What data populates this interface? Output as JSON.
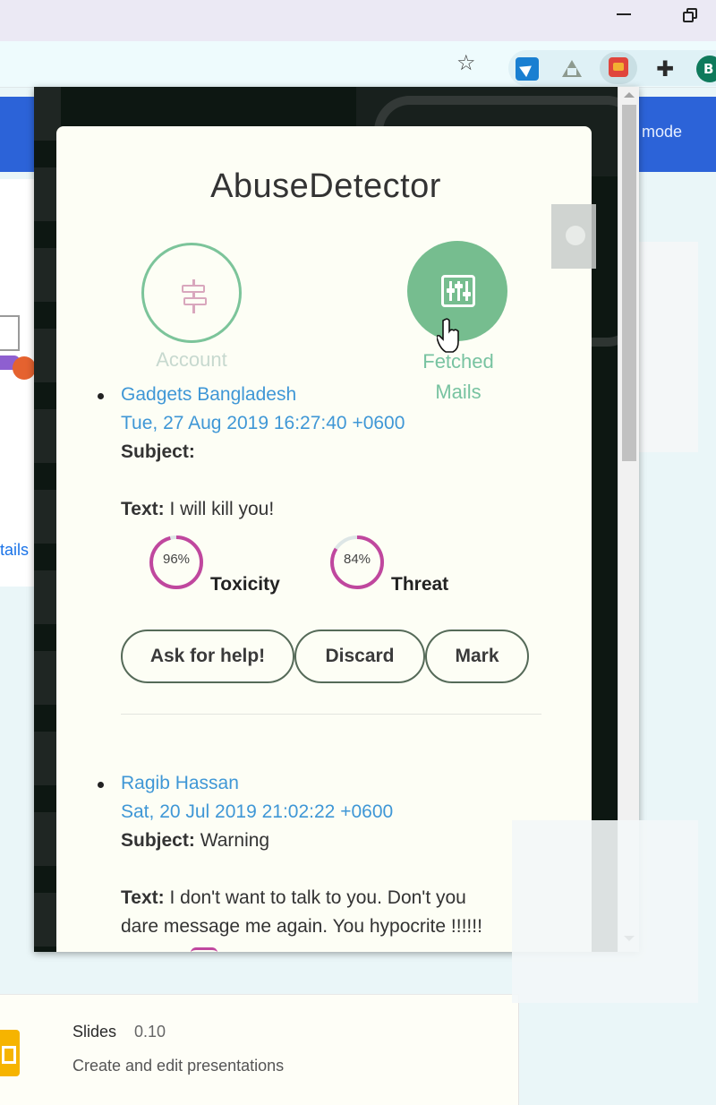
{
  "browser": {
    "avatar_letter": "B",
    "star_icon": "star-icon",
    "extensions": [
      "pointer-extension-icon",
      "drive-extension-icon",
      "abusedetector-extension-icon",
      "puzzle-extensions-icon"
    ]
  },
  "background_page": {
    "mode_label": "r mode",
    "details_link": "tails",
    "slides": {
      "name": "Slides",
      "version": "0.10",
      "description": "Create and edit presentations"
    }
  },
  "popup": {
    "title": "AbuseDetector",
    "nav": {
      "account_label": "Account",
      "fetched_label_line1": "Fetched",
      "fetched_label_line2": "Mails"
    },
    "mails": [
      {
        "sender": "Gadgets Bangladesh",
        "date": "Tue, 27 Aug 2019 16:27:40 +0600",
        "subject_label": "Subject:",
        "subject": "",
        "text_label": "Text:",
        "text": "I will kill you!",
        "scores": [
          {
            "label": "Toxicity",
            "percent_text": "96%",
            "value": 96
          },
          {
            "label": "Threat",
            "percent_text": "84%",
            "value": 84
          }
        ]
      },
      {
        "sender": "Ragib Hassan",
        "date": "Sat, 20 Jul 2019 21:02:22 +0600",
        "subject_label": "Subject:",
        "subject": "Warning",
        "text_label": "Text:",
        "text_line1": "I don't want to talk to you. Don't you",
        "text_line2": "dare message me again. You hypocrite !!!!!!"
      }
    ],
    "actions": {
      "help": "Ask for help!",
      "discard": "Discard",
      "mark": "Mark"
    },
    "colors": {
      "accent_green": "#76bd8f",
      "link_blue": "#3f97d6",
      "ring_magenta": "#c0479e"
    }
  }
}
